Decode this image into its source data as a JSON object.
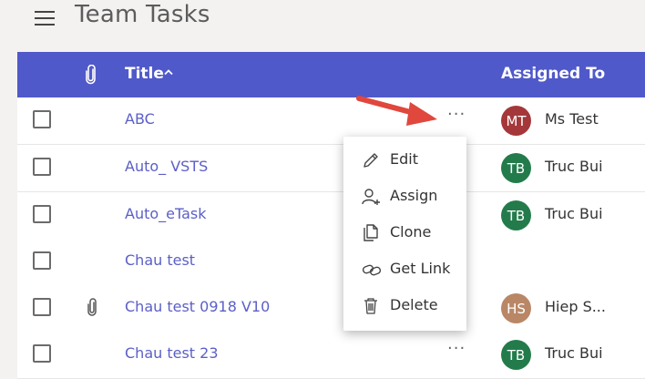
{
  "header": {
    "title": "Team Tasks"
  },
  "table": {
    "columns": {
      "title": "Title",
      "assigned_to": "Assigned To"
    },
    "rows": [
      {
        "title": "ABC",
        "attachment": false,
        "more": "···",
        "avatar": {
          "initials": "MT",
          "color": "#a4373a"
        },
        "assignee": "Ms Test"
      },
      {
        "title": "Auto_ VSTS",
        "attachment": false,
        "more": "",
        "avatar": {
          "initials": "TB",
          "color": "#237b4b"
        },
        "assignee": "Truc Bui"
      },
      {
        "title": "Auto_eTask",
        "attachment": false,
        "more": "",
        "avatar": {
          "initials": "TB",
          "color": "#237b4b"
        },
        "assignee": "Truc Bui"
      },
      {
        "title": "Chau test",
        "attachment": false,
        "more": "",
        "avatar": null,
        "assignee": ""
      },
      {
        "title": "Chau test 0918 V10",
        "attachment": true,
        "more": "",
        "avatar": {
          "initials": "HS",
          "color": "#b98766"
        },
        "assignee": "Hiep S..."
      },
      {
        "title": "Chau test 23",
        "attachment": false,
        "more": "···",
        "avatar": {
          "initials": "TB",
          "color": "#237b4b"
        },
        "assignee": "Truc Bui"
      }
    ]
  },
  "context_menu": {
    "items": [
      {
        "label": "Edit",
        "icon": "pencil-icon"
      },
      {
        "label": "Assign",
        "icon": "assign-person-icon"
      },
      {
        "label": "Clone",
        "icon": "copy-icon"
      },
      {
        "label": "Get Link",
        "icon": "link-icon"
      },
      {
        "label": "Delete",
        "icon": "trash-icon"
      }
    ]
  },
  "colors": {
    "header_bg": "#5059c9",
    "link": "#5b5fc7",
    "annotation_arrow": "#e0473d"
  }
}
